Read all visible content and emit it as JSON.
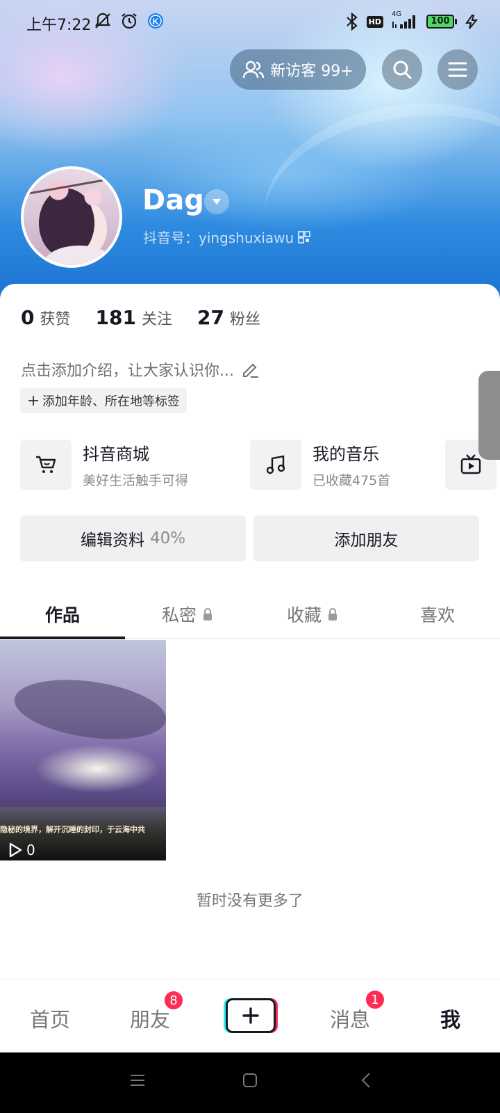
{
  "status_bar": {
    "time": "上午7:22",
    "battery": "100",
    "network": "4G",
    "hd": "HD"
  },
  "header": {
    "visitors_label": "新访客 99+"
  },
  "profile": {
    "username": "Dag",
    "douyin_id": "抖音号：yingshuxiawu"
  },
  "stats": [
    {
      "value": "0",
      "label": "获赞"
    },
    {
      "value": "181",
      "label": "关注"
    },
    {
      "value": "27",
      "label": "粉丝"
    }
  ],
  "bio": {
    "placeholder": "点击添加介绍，让大家认识你...",
    "tag_button": "添加年龄、所在地等标签"
  },
  "shortcuts": [
    {
      "title": "抖音商城",
      "subtitle": "美好生活触手可得",
      "icon": "cart-icon"
    },
    {
      "title": "我的音乐",
      "subtitle": "已收藏475首",
      "icon": "music-icon"
    },
    {
      "title": "",
      "subtitle": "",
      "icon": "tv-icon"
    }
  ],
  "actions": {
    "edit_profile": "编辑资料",
    "edit_progress": "40%",
    "add_friends": "添加朋友"
  },
  "tabs": [
    {
      "label": "作品",
      "active": true,
      "locked": false
    },
    {
      "label": "私密",
      "active": false,
      "locked": true
    },
    {
      "label": "收藏",
      "active": false,
      "locked": true
    },
    {
      "label": "喜欢",
      "active": false,
      "locked": false
    }
  ],
  "videos": [
    {
      "subtitle": "隐秘的境界，解开沉睡的封印，于云海中共",
      "plays": "0"
    }
  ],
  "no_more": "暂时没有更多了",
  "bottom_nav": {
    "home": "首页",
    "friends": "朋友",
    "friends_badge": "8",
    "messages": "消息",
    "messages_badge": "1",
    "me": "我"
  },
  "colors": {
    "accent": "#fe2c55",
    "cyan": "#25f4ee",
    "text": "#161823"
  }
}
